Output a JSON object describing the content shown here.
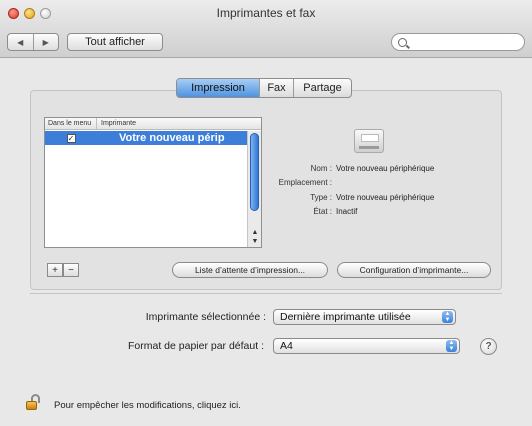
{
  "window": {
    "title": "Imprimantes et fax"
  },
  "toolbar": {
    "back_label": "◀",
    "forward_label": "▶",
    "show_all_label": "Tout afficher",
    "search": {
      "value": "",
      "placeholder": ""
    }
  },
  "tabs": [
    {
      "label": "Impression",
      "active": true
    },
    {
      "label": "Fax",
      "active": false
    },
    {
      "label": "Partage",
      "active": false
    }
  ],
  "printer_list": {
    "columns": [
      "Dans le menu",
      "Imprimante"
    ],
    "rows": [
      {
        "in_menu": "✓",
        "name": "Votre nouveau périp"
      }
    ]
  },
  "details": {
    "name_label": "Nom :",
    "name_value": "Votre nouveau périphérique",
    "location_label": "Emplacement :",
    "location_value": "",
    "type_label": "Type :",
    "type_value": "Votre nouveau périphérique",
    "state_label": "État :",
    "state_value": "Inactif"
  },
  "buttons": {
    "add": "+",
    "remove": "−",
    "print_queue": "Liste d’attente d’impression...",
    "printer_setup": "Configuration d’imprimante..."
  },
  "settings": {
    "selected_printer_label": "Imprimante sélectionnée :",
    "selected_printer_value": "Dernière imprimante utilisée",
    "paper_format_label": "Format de papier par défaut :",
    "paper_format_value": "A4",
    "help_label": "?"
  },
  "lock": {
    "text": "Pour empêcher les modifications, cliquez ici."
  },
  "colors": {
    "accent": "#3d7ed9",
    "window_bg": "#e8e8e8"
  }
}
